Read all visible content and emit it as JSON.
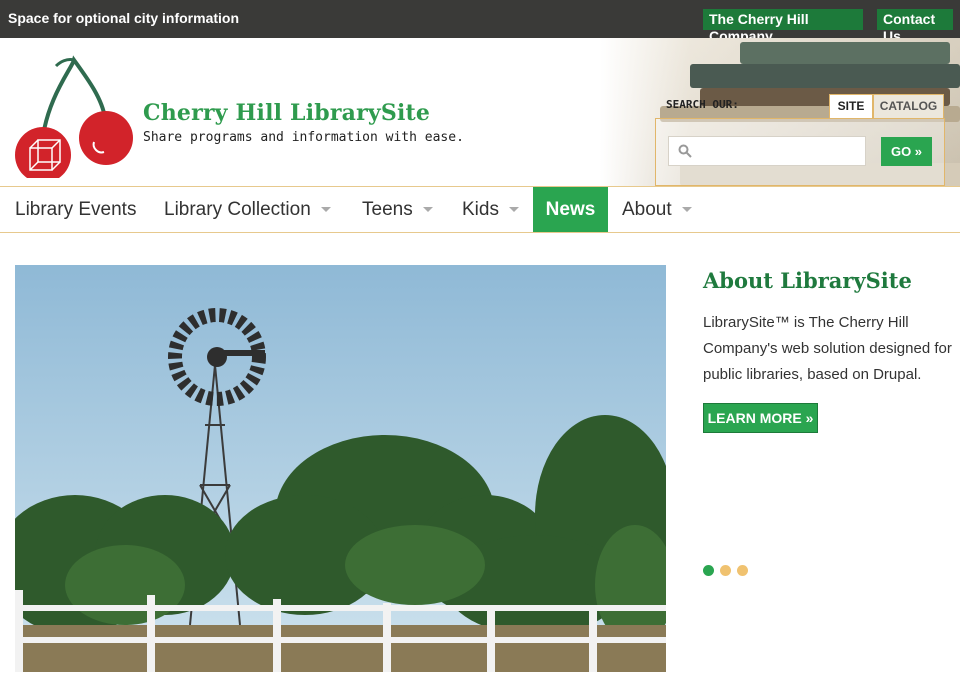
{
  "topbar": {
    "city_info": "Space for optional city information",
    "links": [
      "The Cherry Hill Company",
      "Contact Us"
    ]
  },
  "header": {
    "site_name": "Cherry Hill LibrarySite",
    "slogan": "Share programs and information with ease.",
    "logo_icon": "cherry-logo-icon"
  },
  "search": {
    "label": "SEARCH OUR:",
    "tabs": [
      "SITE",
      "CATALOG"
    ],
    "active_tab": "SITE",
    "placeholder": "",
    "button": "GO »"
  },
  "nav": {
    "items": [
      {
        "label": "Library Events",
        "dropdown": false
      },
      {
        "label": "Library Collection",
        "dropdown": true
      },
      {
        "label": "Teens",
        "dropdown": true
      },
      {
        "label": "Kids",
        "dropdown": true
      },
      {
        "label": "News",
        "dropdown": false,
        "active": true
      },
      {
        "label": "About",
        "dropdown": true
      }
    ]
  },
  "slideshow": {
    "image_icon": "windmill-photo",
    "title": "About LibrarySite",
    "text": "LibrarySite™ is The Cherry Hill Company's web solution designed for public libraries, based on Drupal.",
    "button": "LEARN MORE »",
    "active_slide": 1,
    "total_slides": 3
  },
  "colors": {
    "green": "#2aa550",
    "dark_green": "#1d7a3a",
    "topbar": "#3a3a38",
    "accent_border": "#e7c98d",
    "dot_inactive": "#f0c270"
  }
}
